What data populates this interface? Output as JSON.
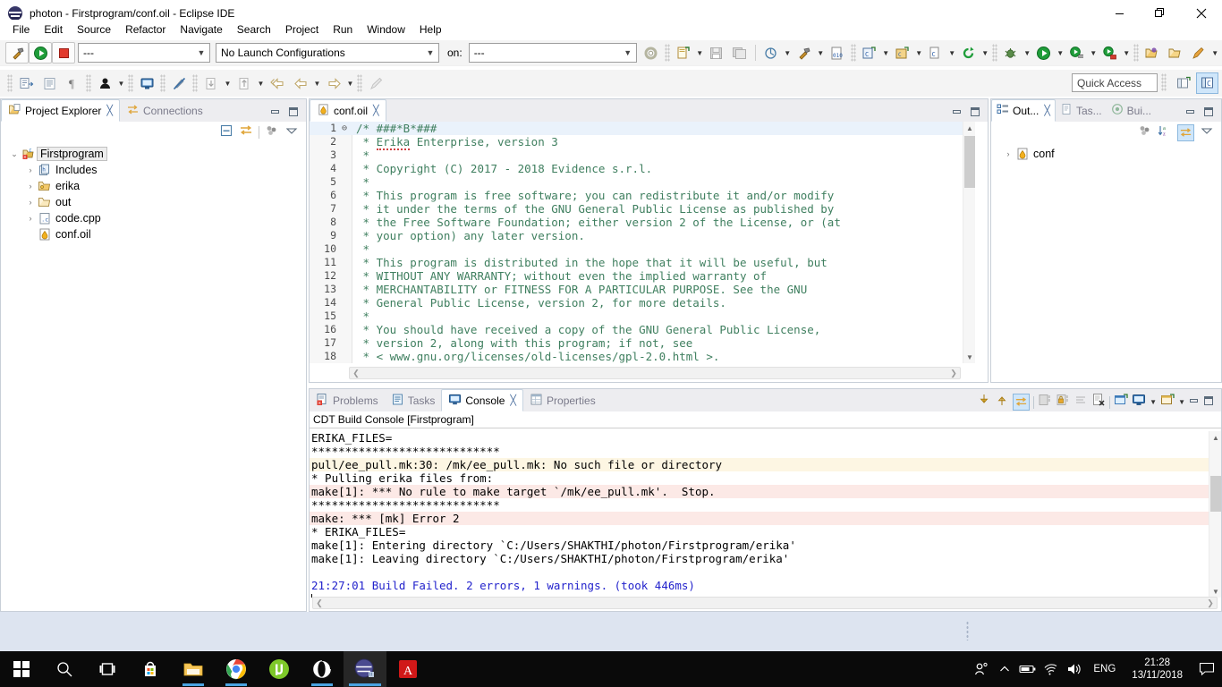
{
  "window": {
    "title": "photon - Firstprogram/conf.oil - Eclipse IDE",
    "app_icon": "eclipse-icon",
    "minimize": "—",
    "maximize": "❐",
    "close": "✕"
  },
  "menubar": {
    "items": [
      "File",
      "Edit",
      "Source",
      "Refactor",
      "Navigate",
      "Search",
      "Project",
      "Run",
      "Window",
      "Help"
    ]
  },
  "toolbar": {
    "build_label": "---",
    "launch_config": "No Launch Configurations",
    "on_label": "on:",
    "on_value": "---",
    "quick_access_placeholder": "Quick Access",
    "icons_left": [
      "build-hammer-icon",
      "run-icon",
      "stop-icon"
    ],
    "icons_right": [
      "new-file-icon",
      "save-icon",
      "save-all-icon",
      "print-icon",
      "build-hammer-icon",
      "binary-icon",
      "new-c-class-icon",
      "new-c-project-icon",
      "new-c-file-icon",
      "new-cvs-icon",
      "debug-icon",
      "run-green-icon",
      "run-config-icon",
      "run-secure-icon",
      "open-type-icon",
      "open-resource-icon",
      "pin-icon"
    ],
    "icons_row2": [
      "toggle-block-selection-icon",
      "show-whitespace-icon",
      "pilcrow-icon",
      "person-icon",
      "console-icon",
      "skip-breakpoints-icon",
      "next-annotation-icon",
      "previous-annotation-icon",
      "back-icon",
      "forward-left-icon",
      "forward-right-icon",
      "pencil-icon"
    ],
    "perspective_buttons": [
      "open-perspective-icon",
      "cpp-perspective-icon"
    ]
  },
  "project_explorer": {
    "tabs": [
      {
        "label": "Project Explorer",
        "icon": "project-explorer-icon",
        "active": true,
        "closable": true
      },
      {
        "label": "Connections",
        "icon": "connections-icon",
        "active": false,
        "closable": false
      }
    ],
    "window_controls": [
      "minimize-icon",
      "maximize-icon"
    ],
    "toolbar_icons": [
      "collapse-all-icon",
      "link-with-editor-icon",
      "view-menu-filter-icon",
      "view-menu-icon"
    ],
    "tree": [
      {
        "label": "Firstprogram",
        "icon": "c-project-icon",
        "twisty": "⌄",
        "indent": 0,
        "selected": true
      },
      {
        "label": "Includes",
        "icon": "includes-icon",
        "twisty": "›",
        "indent": 1,
        "selected": false
      },
      {
        "label": "erika",
        "icon": "source-folder-icon",
        "twisty": "›",
        "indent": 1,
        "selected": false
      },
      {
        "label": "out",
        "icon": "folder-icon",
        "twisty": "›",
        "indent": 1,
        "selected": false
      },
      {
        "label": "code.cpp",
        "icon": "cpp-file-icon",
        "twisty": "›",
        "indent": 1,
        "selected": false
      },
      {
        "label": "conf.oil",
        "icon": "oil-file-icon",
        "twisty": "",
        "indent": 1,
        "selected": false
      }
    ]
  },
  "editor": {
    "tabs": [
      {
        "label": "conf.oil",
        "icon": "oil-file-icon",
        "active": true,
        "closable": true
      }
    ],
    "window_controls": [
      "minimize-icon",
      "maximize-icon"
    ],
    "lines": [
      {
        "n": "1",
        "fold": "⊖",
        "text": "/* ###*B*###",
        "highlight": true
      },
      {
        "n": "2",
        "fold": "",
        "text": " * Erika Enterprise, version 3",
        "highlight": false,
        "spell": "Erika"
      },
      {
        "n": "3",
        "fold": "",
        "text": " *",
        "highlight": false
      },
      {
        "n": "4",
        "fold": "",
        "text": " * Copyright (C) 2017 - 2018 Evidence s.r.l.",
        "highlight": false
      },
      {
        "n": "5",
        "fold": "",
        "text": " *",
        "highlight": false
      },
      {
        "n": "6",
        "fold": "",
        "text": " * This program is free software; you can redistribute it and/or modify",
        "highlight": false
      },
      {
        "n": "7",
        "fold": "",
        "text": " * it under the terms of the GNU General Public License as published by",
        "highlight": false
      },
      {
        "n": "8",
        "fold": "",
        "text": " * the Free Software Foundation; either version 2 of the License, or (at",
        "highlight": false
      },
      {
        "n": "9",
        "fold": "",
        "text": " * your option) any later version.",
        "highlight": false
      },
      {
        "n": "10",
        "fold": "",
        "text": " *",
        "highlight": false
      },
      {
        "n": "11",
        "fold": "",
        "text": " * This program is distributed in the hope that it will be useful, but",
        "highlight": false
      },
      {
        "n": "12",
        "fold": "",
        "text": " * WITHOUT ANY WARRANTY; without even the implied warranty of",
        "highlight": false
      },
      {
        "n": "13",
        "fold": "",
        "text": " * MERCHANTABILITY or FITNESS FOR A PARTICULAR PURPOSE. See the GNU",
        "highlight": false
      },
      {
        "n": "14",
        "fold": "",
        "text": " * General Public License, version 2, for more details.",
        "highlight": false
      },
      {
        "n": "15",
        "fold": "",
        "text": " *",
        "highlight": false
      },
      {
        "n": "16",
        "fold": "",
        "text": " * You should have received a copy of the GNU General Public License,",
        "highlight": false
      },
      {
        "n": "17",
        "fold": "",
        "text": " * version 2, along with this program; if not, see",
        "highlight": false
      },
      {
        "n": "18",
        "fold": "",
        "text": " * < www.gnu.org/licenses/old-licenses/gpl-2.0.html >.",
        "highlight": false
      }
    ]
  },
  "outline": {
    "tabs": [
      {
        "label": "Out...",
        "icon": "outline-icon",
        "active": true,
        "closable": true
      },
      {
        "label": "Tas...",
        "icon": "task-list-icon",
        "active": false,
        "closable": false
      },
      {
        "label": "Bui...",
        "icon": "build-targets-icon",
        "active": false,
        "closable": false
      }
    ],
    "window_controls": [
      "minimize-icon",
      "maximize-icon"
    ],
    "toolbar_icons": [
      "filter-icon",
      "sort-az-icon",
      "link-with-editor-icon",
      "view-menu-icon"
    ],
    "tree": [
      {
        "label": "conf",
        "icon": "oil-file-icon",
        "twisty": "›"
      }
    ]
  },
  "console": {
    "tabs": [
      {
        "label": "Problems",
        "icon": "problems-icon",
        "active": false,
        "closable": false
      },
      {
        "label": "Tasks",
        "icon": "tasks-icon",
        "active": false,
        "closable": false
      },
      {
        "label": "Console",
        "icon": "console-icon",
        "active": true,
        "closable": true
      },
      {
        "label": "Properties",
        "icon": "properties-icon",
        "active": false,
        "closable": false
      }
    ],
    "toolbar_icons": [
      "scroll-lock-down-icon",
      "scroll-lock-up-icon",
      "link-icon",
      "save-console-icon",
      "lock-console-icon",
      "clear-console-icon",
      "remove-console-icon",
      "new-console-view-icon",
      "display-selected-console-icon",
      "open-console-icon",
      "minimize-icon",
      "maximize-icon"
    ],
    "title": "CDT Build Console [Firstprogram]",
    "lines": [
      {
        "text": "ERIKA_FILES=",
        "style": "plain"
      },
      {
        "text": "****************************",
        "style": "plain"
      },
      {
        "text": "pull/ee_pull.mk:30: /mk/ee_pull.mk: No such file or directory",
        "style": "warn"
      },
      {
        "text": "* Pulling erika files from:",
        "style": "plain"
      },
      {
        "text": "make[1]: *** No rule to make target `/mk/ee_pull.mk'.  Stop.",
        "style": "err"
      },
      {
        "text": "****************************",
        "style": "plain"
      },
      {
        "text": "make: *** [mk] Error 2",
        "style": "err"
      },
      {
        "text": "* ERIKA_FILES=",
        "style": "plain"
      },
      {
        "text": "make[1]: Entering directory `C:/Users/SHAKTHI/photon/Firstprogram/erika'",
        "style": "plain"
      },
      {
        "text": "make[1]: Leaving directory `C:/Users/SHAKTHI/photon/Firstprogram/erika'",
        "style": "plain"
      },
      {
        "text": "",
        "style": "plain"
      },
      {
        "text": "21:27:01 Build Failed. 2 errors, 1 warnings. (took 446ms)",
        "style": "info"
      },
      {
        "text": "",
        "style": "caret"
      }
    ]
  },
  "taskbar": {
    "items": [
      {
        "name": "start-button",
        "icon": "windows-logo-icon",
        "running": false,
        "active": false
      },
      {
        "name": "search-button",
        "icon": "search-icon",
        "running": false,
        "active": false
      },
      {
        "name": "task-view-button",
        "icon": "task-view-icon",
        "running": false,
        "active": false
      },
      {
        "name": "microsoft-store",
        "icon": "store-icon",
        "running": false,
        "active": false
      },
      {
        "name": "file-explorer",
        "icon": "folder-icon",
        "running": true,
        "active": false
      },
      {
        "name": "google-chrome",
        "icon": "chrome-icon",
        "running": true,
        "active": false
      },
      {
        "name": "utorrent",
        "icon": "utorrent-icon",
        "running": false,
        "active": false
      },
      {
        "name": "opera",
        "icon": "opera-icon",
        "running": true,
        "active": false
      },
      {
        "name": "eclipse-ide",
        "icon": "eclipse-icon",
        "running": true,
        "active": true
      },
      {
        "name": "adobe-acrobat",
        "icon": "acrobat-icon",
        "running": false,
        "active": false
      }
    ],
    "tray": {
      "people_icon": "people-icon",
      "chevron_icon": "show-hidden-icons-icon",
      "battery_icon": "battery-icon",
      "network_icon": "wifi-icon",
      "volume_icon": "volume-icon",
      "language": "ENG",
      "time": "21:28",
      "date": "13/11/2018",
      "action_center_icon": "action-center-icon"
    }
  },
  "colors": {
    "accent": "#4aa3e0",
    "comment_green": "#3f7f5f",
    "console_info": "#2222cc",
    "warn_bg": "#fdf6e3",
    "err_bg": "#fce9e6",
    "selection": "#eaf2fb"
  }
}
